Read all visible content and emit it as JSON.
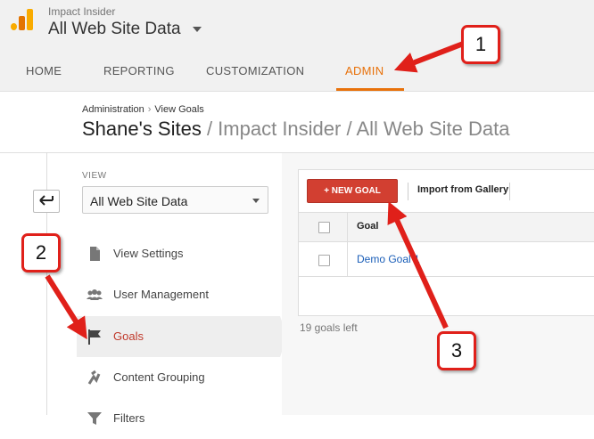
{
  "header": {
    "account_name": "Impact Insider",
    "property_name": "All Web Site Data"
  },
  "nav": {
    "tabs": [
      "HOME",
      "REPORTING",
      "CUSTOMIZATION",
      "ADMIN"
    ],
    "active_tab": "ADMIN"
  },
  "breadcrumb": {
    "items": [
      "Administration",
      "View Goals"
    ],
    "separator": "›"
  },
  "page_title": {
    "main": "Shane's Sites",
    "path": " / Impact Insider / All Web Site Data"
  },
  "sidebar": {
    "back_icon": "back-arrow-icon",
    "view_label": "VIEW",
    "view_selected": "All Web Site Data",
    "items": [
      {
        "label": "View Settings",
        "icon": "document-icon"
      },
      {
        "label": "User Management",
        "icon": "users-icon"
      },
      {
        "label": "Goals",
        "icon": "flag-icon",
        "active": true
      },
      {
        "label": "Content Grouping",
        "icon": "content-grouping-icon"
      },
      {
        "label": "Filters",
        "icon": "filter-icon"
      }
    ]
  },
  "goals_panel": {
    "new_goal_label": "+ NEW GOAL",
    "import_label": "Import from Gallery",
    "column_goal": "Goal",
    "rows": [
      {
        "name": "Demo Goal 1"
      }
    ],
    "goals_left": "19 goals left"
  },
  "annotations": {
    "callouts": [
      "1",
      "2",
      "3"
    ],
    "color": "#e0201a"
  },
  "colors": {
    "admin_accent": "#e8710a",
    "new_goal_button": "#d23f31",
    "link": "#1a5eb8",
    "active_item_text": "#c0392b"
  }
}
